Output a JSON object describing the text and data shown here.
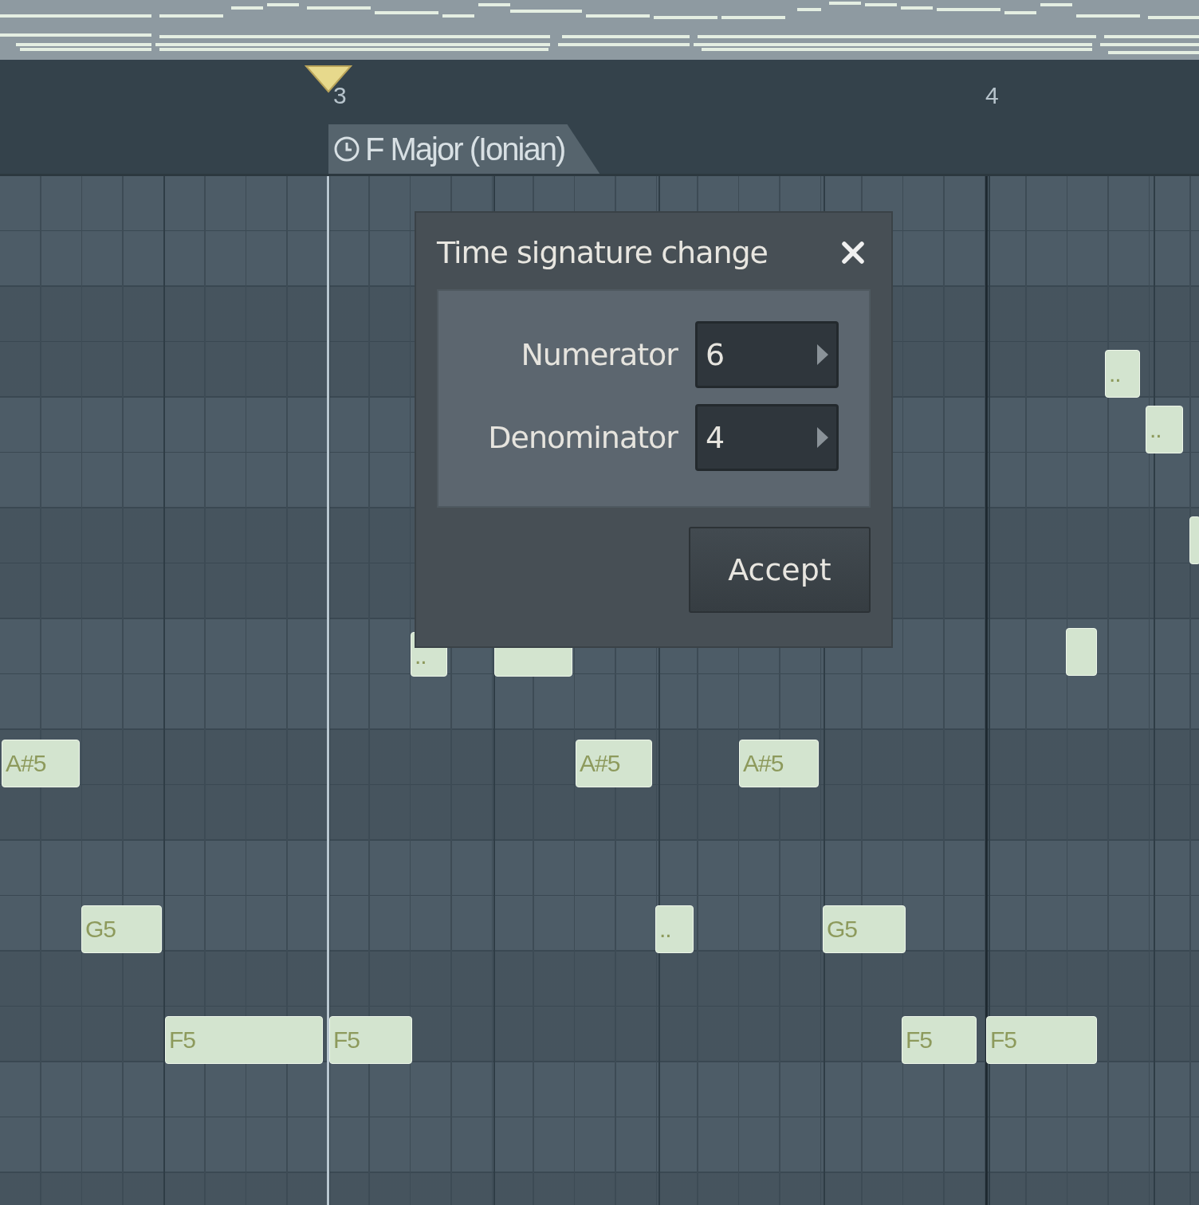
{
  "ruler": {
    "bars": [
      "3",
      "4"
    ]
  },
  "scale_marker": {
    "label": "F Major (Ionian)"
  },
  "notes": [
    {
      "kind": "labeled",
      "label": "A#5"
    },
    {
      "kind": "labeled",
      "label": "A#5"
    },
    {
      "kind": "labeled",
      "label": "A#5"
    },
    {
      "kind": "labeled",
      "label": "G5"
    },
    {
      "kind": "labeled",
      "label": ".."
    },
    {
      "kind": "labeled",
      "label": "G5"
    },
    {
      "kind": "labeled",
      "label": "F5"
    },
    {
      "kind": "labeled",
      "label": "F5"
    },
    {
      "kind": "labeled",
      "label": "F5"
    },
    {
      "kind": "labeled",
      "label": "F5"
    },
    {
      "kind": "labeled",
      "label": ".."
    },
    {
      "kind": "labeled",
      "label": ".."
    },
    {
      "kind": "bare"
    },
    {
      "kind": "bare"
    },
    {
      "kind": "labeled",
      "label": ".."
    },
    {
      "kind": "bare"
    }
  ],
  "dialog": {
    "title": "Time signature change",
    "fields": [
      {
        "label": "Numerator",
        "value": "6"
      },
      {
        "label": "Denominator",
        "value": "4"
      }
    ],
    "button": "Accept"
  }
}
